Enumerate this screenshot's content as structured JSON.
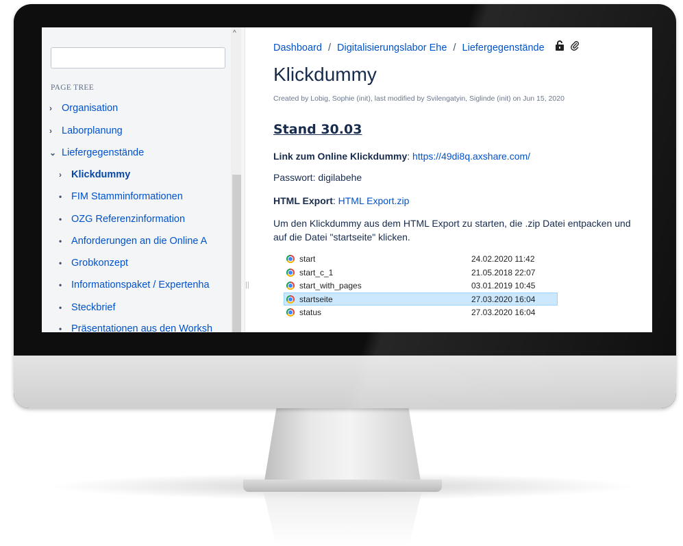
{
  "sidebar": {
    "search": {
      "value": "",
      "placeholder": ""
    },
    "heading": "PAGE TREE",
    "items": [
      {
        "label": "Organisation",
        "icon": "chevron-right-icon",
        "glyph": "›"
      },
      {
        "label": "Laborplanung",
        "icon": "chevron-right-icon",
        "glyph": "›"
      },
      {
        "label": "Liefergegenstände",
        "icon": "chevron-down-icon",
        "glyph": "⌄"
      },
      {
        "label": "Klickdummy",
        "icon": "chevron-right-icon",
        "glyph": "›",
        "current": true
      },
      {
        "label": "FIM Stamminformationen",
        "icon": "bullet-icon",
        "glyph": "•"
      },
      {
        "label": "OZG Referenzinformation",
        "icon": "bullet-icon",
        "glyph": "•"
      },
      {
        "label": "Anforderungen an die Online A",
        "icon": "bullet-icon",
        "glyph": "•"
      },
      {
        "label": "Grobkonzept",
        "icon": "bullet-icon",
        "glyph": "•"
      },
      {
        "label": "Informationspaket / Expertenha",
        "icon": "bullet-icon",
        "glyph": "•"
      },
      {
        "label": "Steckbrief",
        "icon": "bullet-icon",
        "glyph": "•"
      },
      {
        "label": "Präsentationen aus den Worksh",
        "icon": "bullet-icon",
        "glyph": "•"
      }
    ]
  },
  "breadcrumb": {
    "items": [
      "Dashboard",
      "Digitalisierungslabor Ehe",
      "Liefergegenstände"
    ],
    "separator": "/",
    "icons": [
      "unlock-icon",
      "attachment-icon"
    ]
  },
  "page": {
    "title": "Klickdummy",
    "meta": "Created by Lobig, Sophie (init), last modified by Svilengatyin, Siglinde (init) on Jun 15, 2020",
    "section_heading": "Stand 30.03",
    "link_label": "Link zum Online Klickdummy",
    "link_url": "https://49di8q.axshare.com/",
    "password_text": "Passwort: digilabehe",
    "export_label": "HTML Export",
    "export_link": "HTML Export.zip",
    "instructions": "Um den Klickdummy aus dem HTML Export zu starten, die .zip Datei entpacken und auf die Datei \"startseite\" klicken."
  },
  "file_list": [
    {
      "name": "start",
      "date": "24.02.2020 11:42",
      "icon": "chrome-icon"
    },
    {
      "name": "start_c_1",
      "date": "21.05.2018 22:07",
      "icon": "chrome-icon"
    },
    {
      "name": "start_with_pages",
      "date": "03.01.2019 10:45",
      "icon": "chrome-icon"
    },
    {
      "name": "startseite",
      "date": "27.03.2020 16:04",
      "icon": "chrome-icon",
      "selected": true
    },
    {
      "name": "status",
      "date": "27.03.2020 16:04",
      "icon": "chrome-icon"
    }
  ],
  "colors": {
    "link": "#0052cc",
    "text": "#172b4d",
    "sidebar_bg": "#f4f5f7",
    "selection": "#cce8ff"
  }
}
